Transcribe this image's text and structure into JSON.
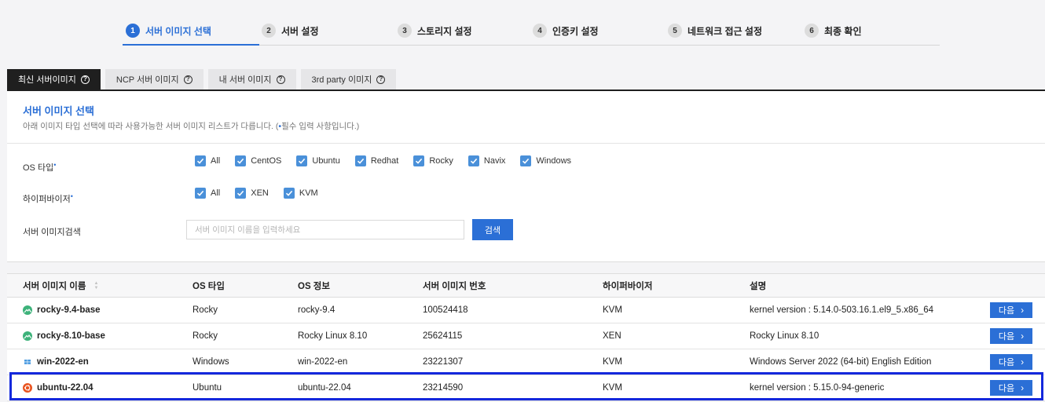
{
  "stepper": {
    "steps": [
      {
        "num": "1",
        "label": "서버 이미지 선택"
      },
      {
        "num": "2",
        "label": "서버 설정"
      },
      {
        "num": "3",
        "label": "스토리지 설정"
      },
      {
        "num": "4",
        "label": "인증키 설정"
      },
      {
        "num": "5",
        "label": "네트워크 접근 설정"
      },
      {
        "num": "6",
        "label": "최종 확인"
      }
    ],
    "active_step": 1
  },
  "tabs": [
    {
      "label": "최신 서버이미지",
      "active": true
    },
    {
      "label": "NCP 서버 이미지",
      "active": false
    },
    {
      "label": "내 서버 이미지",
      "active": false
    },
    {
      "label": "3rd party 이미지",
      "active": false
    }
  ],
  "panel": {
    "title": "서버 이미지 선택",
    "desc_before": "아래 이미지 타입 선택에 따라 사용가능한 서버 이미지 리스트가 다릅니다. (",
    "desc_dot": "•",
    "desc_after": "필수 입력 사항입니다.)",
    "required_mark": "•",
    "os_type_label": "OS 타입",
    "os_type_options": [
      {
        "label": "All",
        "checked": true
      },
      {
        "label": "CentOS",
        "checked": true
      },
      {
        "label": "Ubuntu",
        "checked": true
      },
      {
        "label": "Redhat",
        "checked": true
      },
      {
        "label": "Rocky",
        "checked": true
      },
      {
        "label": "Navix",
        "checked": true
      },
      {
        "label": "Windows",
        "checked": true
      }
    ],
    "hypervisor_label": "하이퍼바이저",
    "hypervisor_options": [
      {
        "label": "All",
        "checked": true
      },
      {
        "label": "XEN",
        "checked": true
      },
      {
        "label": "KVM",
        "checked": true
      }
    ],
    "search_label": "서버 이미지검색",
    "search_placeholder": "서버 이미지 이름을 입력하세요",
    "search_value": "",
    "search_button": "검색"
  },
  "table": {
    "columns": [
      "서버 이미지 이름",
      "OS 타입",
      "OS 정보",
      "서버 이미지 번호",
      "하이퍼바이저",
      "설명"
    ],
    "rows": [
      {
        "name": "rocky-9.4-base",
        "icon": "rocky-icon",
        "os_type": "Rocky",
        "os_info": "rocky-9.4",
        "image_no": "100524418",
        "hypervisor": "KVM",
        "desc": "kernel version : 5.14.0-503.16.1.el9_5.x86_64",
        "action": "다음"
      },
      {
        "name": "rocky-8.10-base",
        "icon": "rocky-icon",
        "os_type": "Rocky",
        "os_info": "Rocky Linux 8.10",
        "image_no": "25624115",
        "hypervisor": "XEN",
        "desc": "Rocky Linux 8.10",
        "action": "다음"
      },
      {
        "name": "win-2022-en",
        "icon": "windows-icon",
        "os_type": "Windows",
        "os_info": "win-2022-en",
        "image_no": "23221307",
        "hypervisor": "KVM",
        "desc": "Windows Server 2022 (64-bit) English Edition",
        "action": "다음"
      },
      {
        "name": "ubuntu-22.04",
        "icon": "ubuntu-icon",
        "os_type": "Ubuntu",
        "os_info": "ubuntu-22.04",
        "image_no": "23214590",
        "hypervisor": "KVM",
        "desc": "kernel version : 5.15.0-94-generic",
        "action": "다음"
      }
    ]
  },
  "colors": {
    "accent": "#2b6fd6",
    "highlight": "#1428dc",
    "active_tab": "#1f1f1f"
  }
}
